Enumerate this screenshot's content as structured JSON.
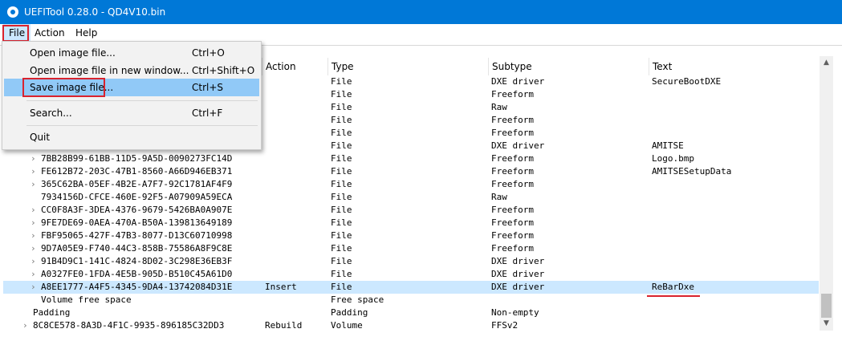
{
  "window": {
    "title": "UEFITool 0.28.0 - QD4V10.bin"
  },
  "menubar": {
    "file": "File",
    "action": "Action",
    "help": "Help"
  },
  "file_menu": {
    "items": [
      {
        "label": "Open image file...",
        "shortcut": "Ctrl+O"
      },
      {
        "label": "Open image file in new window...",
        "shortcut": "Ctrl+Shift+O"
      },
      {
        "label": "Save image file...",
        "shortcut": "Ctrl+S"
      },
      {
        "label": "Search...",
        "shortcut": "Ctrl+F"
      },
      {
        "label": "Quit",
        "shortcut": ""
      }
    ]
  },
  "tree": {
    "columns": [
      "Action",
      "Type",
      "Subtype",
      "Text"
    ],
    "rows": [
      {
        "name": "",
        "action": "",
        "type": "File",
        "subtype": "DXE driver",
        "text": "SecureBootDXE"
      },
      {
        "name": "",
        "action": "",
        "type": "File",
        "subtype": "Freeform",
        "text": ""
      },
      {
        "name": "",
        "action": "",
        "type": "File",
        "subtype": "Raw",
        "text": ""
      },
      {
        "name": "",
        "action": "",
        "type": "File",
        "subtype": "Freeform",
        "text": ""
      },
      {
        "name": "",
        "action": "",
        "type": "File",
        "subtype": "Freeform",
        "text": ""
      },
      {
        "name": "",
        "action": "",
        "type": "File",
        "subtype": "DXE driver",
        "text": "AMITSE"
      },
      {
        "name": "7BB28B99-61BB-11D5-9A5D-0090273FC14D",
        "action": "",
        "type": "File",
        "subtype": "Freeform",
        "text": "Logo.bmp"
      },
      {
        "name": "FE612B72-203C-47B1-8560-A66D946EB371",
        "action": "",
        "type": "File",
        "subtype": "Freeform",
        "text": "AMITSESetupData"
      },
      {
        "name": "365C62BA-05EF-4B2E-A7F7-92C1781AF4F9",
        "action": "",
        "type": "File",
        "subtype": "Freeform",
        "text": ""
      },
      {
        "name": "7934156D-CFCE-460E-92F5-A07909A59ECA",
        "action": "",
        "type": "File",
        "subtype": "Raw",
        "text": ""
      },
      {
        "name": "CC0F8A3F-3DEA-4376-9679-5426BA0A907E",
        "action": "",
        "type": "File",
        "subtype": "Freeform",
        "text": ""
      },
      {
        "name": "9FE7DE69-0AEA-470A-B50A-139813649189",
        "action": "",
        "type": "File",
        "subtype": "Freeform",
        "text": ""
      },
      {
        "name": "FBF95065-427F-47B3-8077-D13C60710998",
        "action": "",
        "type": "File",
        "subtype": "Freeform",
        "text": ""
      },
      {
        "name": "9D7A05E9-F740-44C3-858B-75586A8F9C8E",
        "action": "",
        "type": "File",
        "subtype": "Freeform",
        "text": ""
      },
      {
        "name": "91B4D9C1-141C-4824-8D02-3C298E36EB3F",
        "action": "",
        "type": "File",
        "subtype": "DXE driver",
        "text": ""
      },
      {
        "name": "A0327FE0-1FDA-4E5B-905D-B510C45A61D0",
        "action": "",
        "type": "File",
        "subtype": "DXE driver",
        "text": ""
      },
      {
        "name": "A8EE1777-A4F5-4345-9DA4-13742084D31E",
        "action": "Insert",
        "type": "File",
        "subtype": "DXE driver",
        "text": "ReBarDxe"
      },
      {
        "name": "Volume free space",
        "action": "",
        "type": "Free space",
        "subtype": "",
        "text": ""
      },
      {
        "name": "Padding",
        "action": "",
        "type": "Padding",
        "subtype": "Non-empty",
        "text": ""
      },
      {
        "name": "8C8CE578-8A3D-4F1C-9935-896185C32DD3",
        "action": "Rebuild",
        "type": "Volume",
        "subtype": "FFSv2",
        "text": ""
      }
    ]
  },
  "colors": {
    "titlebar": "#0078d7",
    "selection": "#cce8ff",
    "menu_highlight": "#91c9f7",
    "annotation_red": "#d9232e"
  }
}
